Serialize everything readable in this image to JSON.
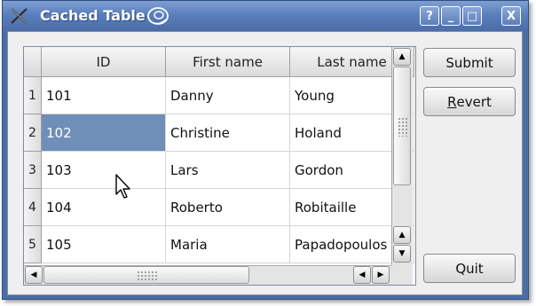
{
  "window": {
    "title": "Cached Table",
    "controls": {
      "help": "?",
      "minimize": "_",
      "maximize": "□",
      "close": "X"
    }
  },
  "table": {
    "columns": [
      "ID",
      "First name",
      "Last name"
    ],
    "rows": [
      {
        "num": "1",
        "id": "101",
        "first": "Danny",
        "last": "Young"
      },
      {
        "num": "2",
        "id": "102",
        "first": "Christine",
        "last": "Holand"
      },
      {
        "num": "3",
        "id": "103",
        "first": "Lars",
        "last": "Gordon"
      },
      {
        "num": "4",
        "id": "104",
        "first": "Roberto",
        "last": "Robitaille"
      },
      {
        "num": "5",
        "id": "105",
        "first": "Maria",
        "last": "Papadopoulos"
      }
    ],
    "selected_cell": {
      "row": 2,
      "column": "ID"
    }
  },
  "buttons": {
    "submit": "Submit",
    "revert_first": "R",
    "revert_rest": "evert",
    "quit": "Quit"
  },
  "colors": {
    "titlebar": "#4a6ea8",
    "selection": "#6f8fb8"
  }
}
